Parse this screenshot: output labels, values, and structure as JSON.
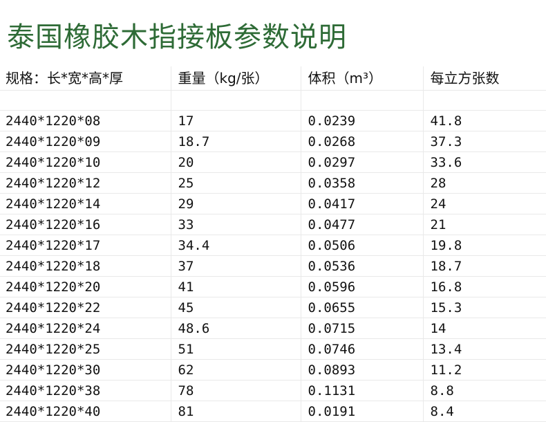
{
  "title": "泰国橡胶木指接板参数说明",
  "table": {
    "headers": [
      "规格：长*宽*高*厚",
      "重量（kg/张）",
      "体积（m³）",
      "每立方张数"
    ],
    "rows": [
      [
        "2440*1220*08",
        "17",
        "0.0239",
        "41.8"
      ],
      [
        "2440*1220*09",
        "18.7",
        "0.0268",
        "37.3"
      ],
      [
        "2440*1220*10",
        "20",
        "0.0297",
        "33.6"
      ],
      [
        "2440*1220*12",
        "25",
        "0.0358",
        "28"
      ],
      [
        "2440*1220*14",
        "29",
        "0.0417",
        "24"
      ],
      [
        "2440*1220*16",
        "33",
        "0.0477",
        "21"
      ],
      [
        "2440*1220*17",
        "34.4",
        "0.0506",
        "19.8"
      ],
      [
        "2440*1220*18",
        "37",
        "0.0536",
        "18.7"
      ],
      [
        "2440*1220*20",
        "41",
        "0.0596",
        "16.8"
      ],
      [
        "2440*1220*22",
        "45",
        "0.0655",
        "15.3"
      ],
      [
        "2440*1220*24",
        "48.6",
        "0.0715",
        "14"
      ],
      [
        "2440*1220*25",
        "51",
        "0.0746",
        "13.4"
      ],
      [
        "2440*1220*30",
        "62",
        "0.0893",
        "11.2"
      ],
      [
        "2440*1220*38",
        "78",
        "0.1131",
        "8.8"
      ],
      [
        "2440*1220*40",
        "81",
        "0.0191",
        "8.4"
      ]
    ]
  },
  "colors": {
    "title": "#2e6b36",
    "text": "#111111",
    "gridline": "#e9e9e9"
  }
}
